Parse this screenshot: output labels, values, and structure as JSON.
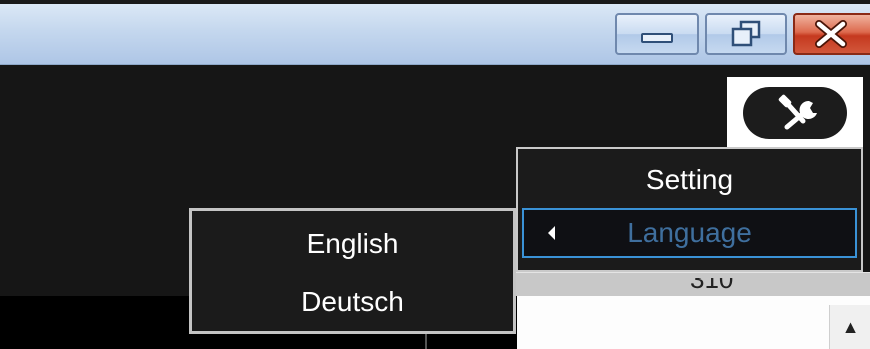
{
  "window_controls": {
    "minimize_icon": "minimize-icon",
    "restore_icon": "restore-icon",
    "close_icon": "close-icon"
  },
  "toolbar": {
    "tools_icon": "tools-icon"
  },
  "context_menu": {
    "items": [
      {
        "label": "Setting"
      },
      {
        "label": "Language",
        "has_submenu": true,
        "highlighted": true
      }
    ],
    "highlight_color": "#3a92d6"
  },
  "language_submenu": {
    "items": [
      {
        "label": "English"
      },
      {
        "label": "Deutsch"
      }
    ]
  },
  "background_text": {
    "clipped_label": "310"
  },
  "scrollbar": {
    "up_arrow": "▲"
  }
}
